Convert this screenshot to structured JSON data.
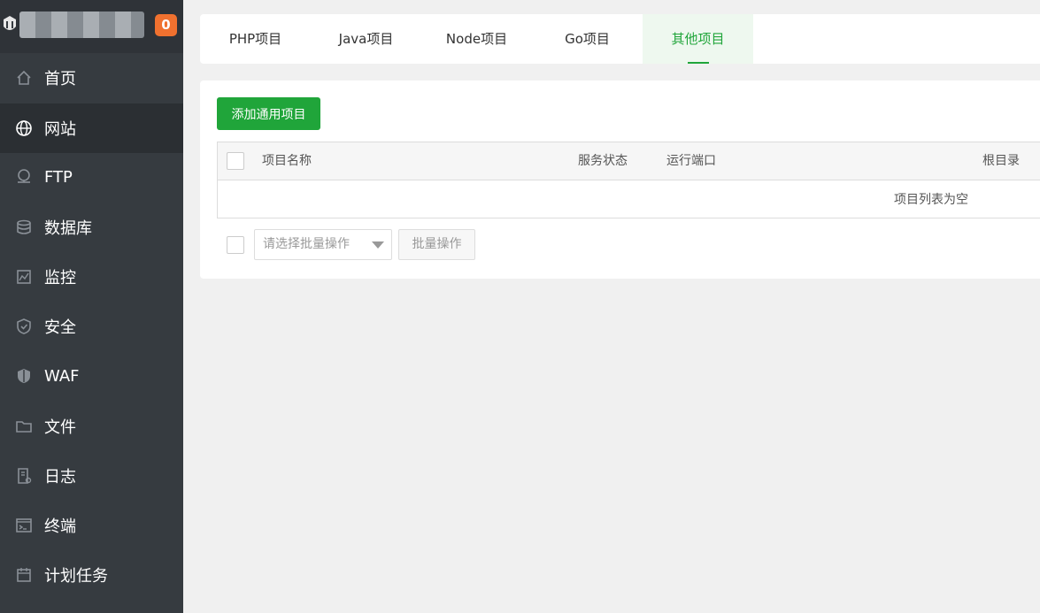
{
  "sidebar": {
    "badge": "0",
    "items": [
      {
        "label": "首页",
        "icon": "home-icon"
      },
      {
        "label": "网站",
        "icon": "globe-icon",
        "active": true
      },
      {
        "label": "FTP",
        "icon": "ftp-icon"
      },
      {
        "label": "数据库",
        "icon": "database-icon"
      },
      {
        "label": "监控",
        "icon": "monitor-icon"
      },
      {
        "label": "安全",
        "icon": "shield-icon"
      },
      {
        "label": "WAF",
        "icon": "waf-icon"
      },
      {
        "label": "文件",
        "icon": "folder-icon"
      },
      {
        "label": "日志",
        "icon": "log-icon"
      },
      {
        "label": "终端",
        "icon": "terminal-icon"
      },
      {
        "label": "计划任务",
        "icon": "calendar-icon"
      }
    ]
  },
  "tabs": [
    {
      "label": "PHP项目"
    },
    {
      "label": "Java项目"
    },
    {
      "label": "Node项目"
    },
    {
      "label": "Go项目"
    },
    {
      "label": "其他项目",
      "active": true
    }
  ],
  "main": {
    "add_button": "添加通用项目",
    "table": {
      "headers": [
        "项目名称",
        "服务状态",
        "运行端口",
        "根目录"
      ],
      "empty_text": "项目列表为空"
    },
    "batch": {
      "select_placeholder": "请选择批量操作",
      "button": "批量操作"
    }
  },
  "colors": {
    "sidebar_bg": "#363b40",
    "accent": "#20a53a",
    "badge": "#f0712f"
  }
}
